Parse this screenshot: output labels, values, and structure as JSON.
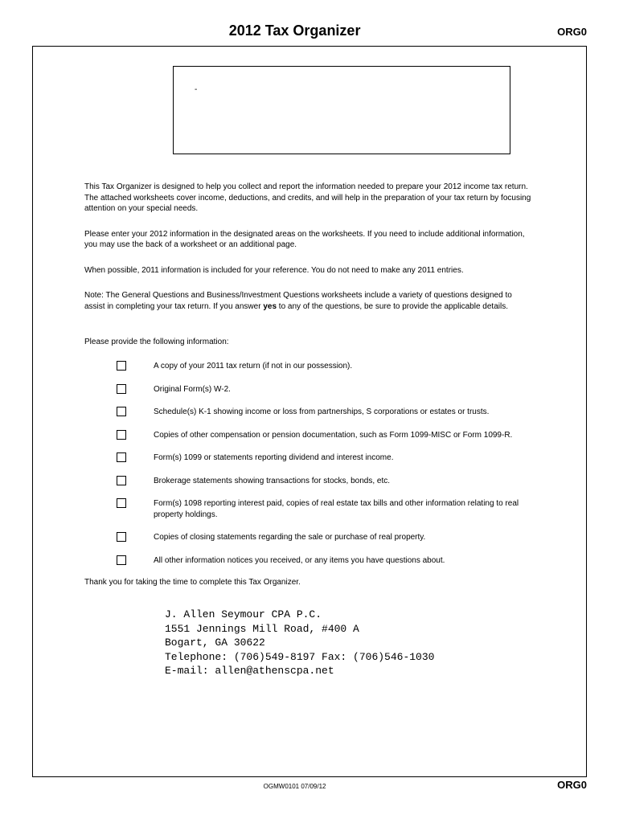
{
  "header": {
    "title": "2012 Tax Organizer",
    "form_code": "ORG0"
  },
  "address_box": {
    "placeholder": "-"
  },
  "paragraphs": {
    "intro": "This Tax Organizer is designed to help you collect and report the information needed to prepare your 2012 income tax return. The attached worksheets cover income, deductions, and credits, and will help in the preparation of your tax return by focusing attention on your special needs.",
    "instructions": "Please enter your 2012 information in the designated areas on the worksheets. If you need to include additional information, you may use the back of a worksheet or an additional page.",
    "reference": "When possible, 2011 information is included for your reference. You do not need to make any 2011 entries.",
    "note_prefix": "Note: The General Questions and Business/Investment Questions worksheets include a variety of questions designed to assist in completing your tax return. If you answer ",
    "note_bold": "yes",
    "note_suffix": " to any of the questions, be sure to provide the applicable details.",
    "provide": "Please provide the following information:",
    "thank_you": "Thank you for taking the time to complete this Tax Organizer."
  },
  "checklist": [
    "A copy of your 2011 tax return (if not in our possession).",
    "Original Form(s) W-2.",
    "Schedule(s) K-1 showing income or loss from partnerships, S corporations or estates or trusts.",
    "Copies of other compensation or pension documentation, such as Form 1099-MISC or Form 1099-R.",
    "Form(s) 1099 or statements reporting dividend and interest income.",
    "Brokerage statements showing transactions for stocks, bonds, etc.",
    "Form(s) 1098 reporting interest paid, copies of real estate tax bills and other information relating to real property holdings.",
    "Copies of closing statements regarding the sale or purchase of real property.",
    "All other information notices you received, or any items you have questions about."
  ],
  "contact": {
    "name": "J. Allen Seymour CPA P.C.",
    "street": "1551 Jennings Mill Road, #400 A",
    "city_state": "Bogart, GA 30622",
    "phone_fax": "Telephone: (706)549-8197  Fax: (706)546-1030",
    "email": "E-mail: allen@athenscpa.net"
  },
  "footer": {
    "left": "OGMW0101     07/09/12",
    "right": "ORG0"
  }
}
